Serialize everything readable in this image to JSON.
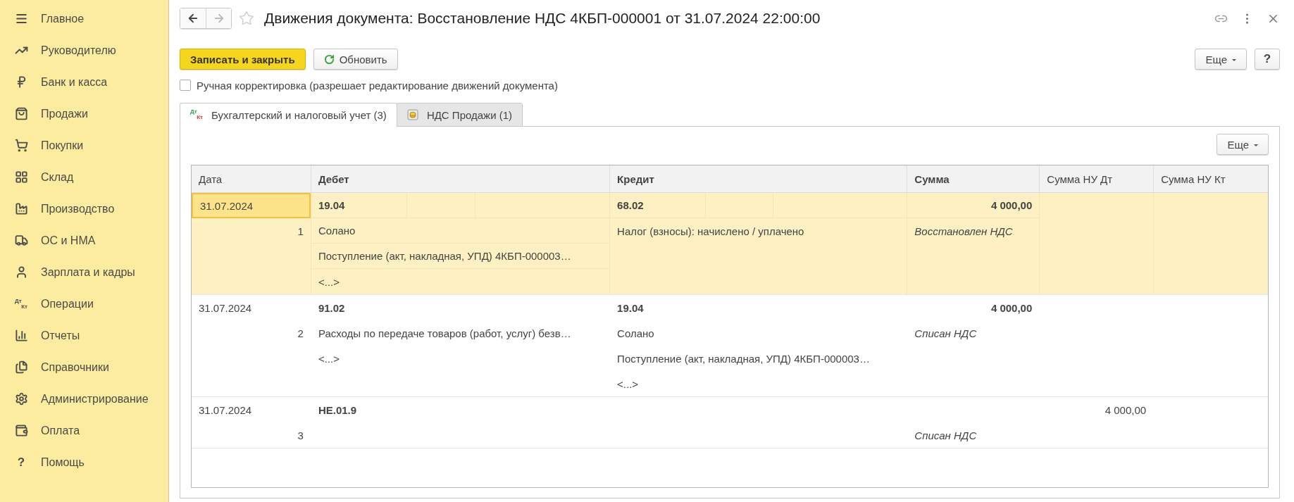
{
  "sidebar": {
    "items": [
      {
        "label": "Главное"
      },
      {
        "label": "Руководителю"
      },
      {
        "label": "Банк и касса"
      },
      {
        "label": "Продажи"
      },
      {
        "label": "Покупки"
      },
      {
        "label": "Склад"
      },
      {
        "label": "Производство"
      },
      {
        "label": "ОС и НМА"
      },
      {
        "label": "Зарплата и кадры"
      },
      {
        "label": "Операции",
        "icon_text": [
          "Дт",
          "Кт"
        ]
      },
      {
        "label": "Отчеты"
      },
      {
        "label": "Справочники"
      },
      {
        "label": "Администрирование"
      },
      {
        "label": "Оплата"
      },
      {
        "label": "Помощь",
        "icon_char": "?"
      }
    ]
  },
  "header": {
    "title": "Движения документа: Восстановление НДС 4КБП-000001 от 31.07.2024 22:00:00"
  },
  "toolbar": {
    "primary": "Записать и закрыть",
    "refresh": "Обновить",
    "more": "Еще",
    "help": "?"
  },
  "manual_edit": {
    "label": "Ручная корректировка (разрешает редактирование движений документа)",
    "checked": false
  },
  "tabs": [
    {
      "label": "Бухгалтерский и налоговый учет (3)",
      "selected": true,
      "kind": "dtkt",
      "icon_text": [
        "Дт",
        "Кт"
      ]
    },
    {
      "label": "НДС Продажи (1)",
      "selected": false,
      "kind": "coins"
    }
  ],
  "table": {
    "more": "Еще",
    "columns": [
      {
        "label": "Дата",
        "bold": false
      },
      {
        "label": "Дебет",
        "bold": true
      },
      {
        "label": "Кредит",
        "bold": true
      },
      {
        "label": "Сумма",
        "bold": true
      },
      {
        "label": "Сумма НУ Дт",
        "bold": false
      },
      {
        "label": "Сумма НУ Кт",
        "bold": false
      }
    ],
    "rows": [
      {
        "selected": true,
        "date": "31.07.2024",
        "number": "1",
        "debit": {
          "account": "19.04",
          "lines": [
            "Солано",
            "Поступление (акт, накладная, УПД) 4КБП-000003…",
            "<...>"
          ]
        },
        "credit": {
          "account": "68.02",
          "lines": [
            "Налог (взносы): начислено / уплачено"
          ]
        },
        "sum": "4 000,00",
        "comment": "Восстановлен НДС"
      },
      {
        "selected": false,
        "date": "31.07.2024",
        "number": "2",
        "debit": {
          "account": "91.02",
          "lines": [
            "Расходы по передаче товаров (работ, услуг) безв…",
            "<...>"
          ]
        },
        "credit": {
          "account": "19.04",
          "lines": [
            "Солано",
            "Поступление (акт, накладная, УПД) 4КБП-000003…",
            "<...>"
          ]
        },
        "sum": "4 000,00",
        "comment": "Списан НДС"
      },
      {
        "selected": false,
        "date": "31.07.2024",
        "number": "3",
        "debit": {
          "account": "НЕ.01.9"
        },
        "sum_nu_dt": "4 000,00",
        "comment": "Списан НДС"
      }
    ]
  }
}
